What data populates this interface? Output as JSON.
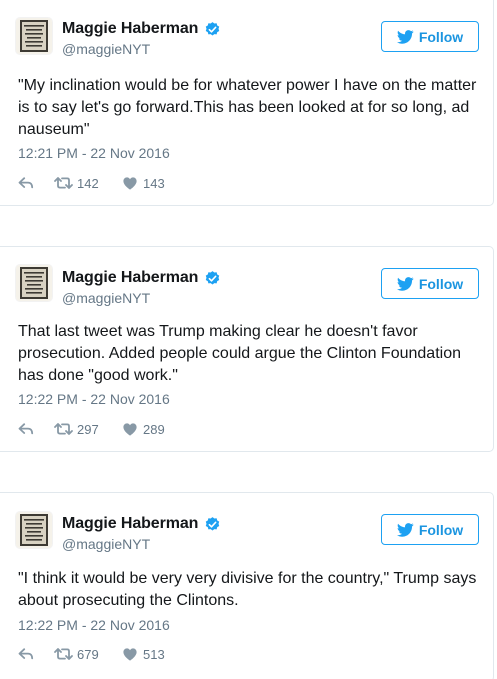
{
  "colors": {
    "accent": "#1da1f2",
    "text": "#14171a",
    "muted": "#657786",
    "border": "#e1e8ed"
  },
  "tweets": [
    {
      "name": "Maggie Haberman",
      "handle": "@maggieNYT",
      "verified": true,
      "follow_label": "Follow",
      "text": "\"My inclination would be for whatever power I have on the matter is to say let's go forward.This has been looked at for so long, ad nauseum\"",
      "timestamp": "12:21 PM - 22 Nov 2016",
      "retweets": "142",
      "likes": "143"
    },
    {
      "name": "Maggie Haberman",
      "handle": "@maggieNYT",
      "verified": true,
      "follow_label": "Follow",
      "text": "That last tweet was Trump making clear he doesn't favor prosecution. Added people could argue the Clinton Foundation has done \"good work.\"",
      "timestamp": "12:22 PM - 22 Nov 2016",
      "retweets": "297",
      "likes": "289"
    },
    {
      "name": "Maggie Haberman",
      "handle": "@maggieNYT",
      "verified": true,
      "follow_label": "Follow",
      "text": "\"I think it would be very very divisive for the country,\" Trump says about prosecuting the Clintons.",
      "timestamp": "12:22 PM - 22 Nov 2016",
      "retweets": "679",
      "likes": "513"
    }
  ],
  "icons": {
    "avatar": "sign-avatar-icon",
    "verified": "verified-badge-icon",
    "follow": "twitter-bird-icon",
    "reply": "reply-icon",
    "retweet": "retweet-icon",
    "like": "heart-icon"
  }
}
